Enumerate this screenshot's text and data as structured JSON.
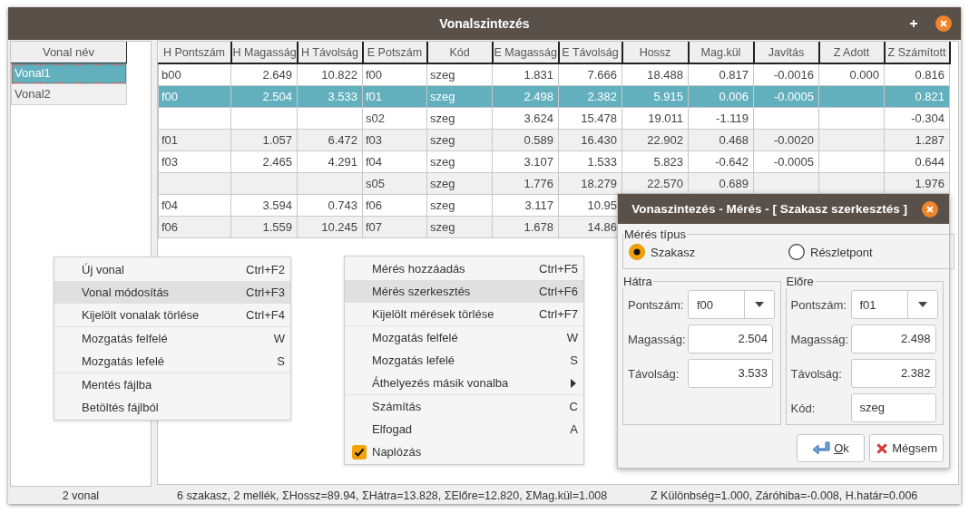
{
  "window": {
    "title": "Vonalszintezés"
  },
  "lines": {
    "header": "Vonal név",
    "items": [
      {
        "label": "Vonal1",
        "selected": true
      },
      {
        "label": "Vonal2",
        "selected": false
      }
    ]
  },
  "table": {
    "columns": [
      "H Pontszám",
      "H Magasság",
      "H Távolság",
      "E Potszám",
      "Kód",
      "E Magasság",
      "E Távolság",
      "Hossz",
      "Mag.kül",
      "Javítás",
      "Z Adott",
      "Z Számított"
    ],
    "rows": [
      {
        "selected": false,
        "cells": [
          "b00",
          "2.649",
          "10.822",
          "f00",
          "szeg",
          "1.831",
          "7.666",
          "18.488",
          "0.817",
          "-0.0016",
          "0.000",
          "0.816"
        ]
      },
      {
        "selected": true,
        "cells": [
          "f00",
          "2.504",
          "3.533",
          "f01",
          "szeg",
          "2.498",
          "2.382",
          "5.915",
          "0.006",
          "-0.0005",
          null,
          "0.821"
        ]
      },
      {
        "selected": false,
        "cells": [
          null,
          null,
          null,
          "s02",
          "szeg",
          "3.624",
          "15.478",
          "19.011",
          "-1.119",
          null,
          null,
          "-0.304"
        ]
      },
      {
        "selected": false,
        "cells": [
          "f01",
          "1.057",
          "6.472",
          "f03",
          "szeg",
          "0.589",
          "16.430",
          "22.902",
          "0.468",
          "-0.0020",
          null,
          "1.287"
        ]
      },
      {
        "selected": false,
        "cells": [
          "f03",
          "2.465",
          "4.291",
          "f04",
          "szeg",
          "3.107",
          "1.533",
          "5.823",
          "-0.642",
          "-0.0005",
          null,
          "0.644"
        ]
      },
      {
        "selected": false,
        "cells": [
          null,
          null,
          null,
          "s05",
          "szeg",
          "1.776",
          "18.279",
          "22.570",
          "0.689",
          null,
          null,
          "1.976"
        ]
      },
      {
        "selected": false,
        "cells": [
          "f04",
          "3.594",
          "0.743",
          "f06",
          "szeg",
          "3.117",
          "10.95"
        ]
      },
      {
        "selected": false,
        "cells": [
          "f06",
          "1.559",
          "10.245",
          "f07",
          "szeg",
          "1.678",
          "14.86"
        ]
      }
    ]
  },
  "context_menus": [
    {
      "items": [
        {
          "kind": "action",
          "label": "Új vonal",
          "shortcut": "Ctrl+F2",
          "selected": false
        },
        {
          "kind": "action",
          "label": "Vonal módosítás",
          "shortcut": "Ctrl+F3",
          "selected": true
        },
        {
          "kind": "action",
          "label": "Kijelölt vonalak törlése",
          "shortcut": "Ctrl+F4",
          "selected": false
        },
        {
          "kind": "separator"
        },
        {
          "kind": "action",
          "label": "Mozgatás felfelé",
          "shortcut": "W",
          "selected": false
        },
        {
          "kind": "action",
          "label": "Mozgatás lefelé",
          "shortcut": "S",
          "selected": false
        },
        {
          "kind": "separator"
        },
        {
          "kind": "action",
          "label": "Mentés fájlba",
          "selected": false
        },
        {
          "kind": "action",
          "label": "Betöltés fájlból",
          "selected": false
        }
      ]
    },
    {
      "items": [
        {
          "kind": "action",
          "label": "Mérés hozzáadás",
          "shortcut": "Ctrl+F5",
          "selected": false
        },
        {
          "kind": "action",
          "label": "Mérés szerkesztés",
          "shortcut": "Ctrl+F6",
          "selected": true
        },
        {
          "kind": "action",
          "label": "Kijelölt mérések törlése",
          "shortcut": "Ctrl+F7",
          "selected": false
        },
        {
          "kind": "separator"
        },
        {
          "kind": "action",
          "label": "Mozgatás felfelé",
          "shortcut": "W",
          "selected": false
        },
        {
          "kind": "action",
          "label": "Mozgatás lefelé",
          "shortcut": "S",
          "selected": false
        },
        {
          "kind": "submenu",
          "label": "Áthelyezés másik vonalba",
          "selected": false
        },
        {
          "kind": "separator"
        },
        {
          "kind": "action",
          "label": "Számítás",
          "shortcut": "C",
          "selected": false
        },
        {
          "kind": "action",
          "label": "Elfogad",
          "shortcut": "A",
          "selected": false
        },
        {
          "kind": "check",
          "label": "Naplózás",
          "checked": true,
          "selected": false
        }
      ]
    }
  ],
  "dialog": {
    "title": "Vonaszintezés - Mérés - [ Szakasz szerkesztés ]",
    "type_group": {
      "title": "Mérés típus",
      "options": [
        {
          "label": "Szakasz",
          "selected": true
        },
        {
          "label": "Részletpont",
          "selected": false
        }
      ]
    },
    "groups": [
      {
        "title": "Hátra",
        "fields": [
          {
            "kind": "combo",
            "label": "Pontszám:",
            "value": "f00"
          },
          {
            "kind": "number",
            "label": "Magasság:",
            "value": "2.504"
          },
          {
            "kind": "number",
            "label": "Távolság:",
            "value": "3.533"
          }
        ]
      },
      {
        "title": "Előre",
        "fields": [
          {
            "kind": "combo",
            "label": "Pontszám:",
            "value": "f01"
          },
          {
            "kind": "number",
            "label": "Magasság:",
            "value": "2.498"
          },
          {
            "kind": "number",
            "label": "Távolság:",
            "value": "2.382"
          },
          {
            "kind": "text",
            "label": "Kód:",
            "value": "szeg"
          }
        ]
      }
    ],
    "buttons": [
      {
        "kind": "ok",
        "label": "Ok"
      },
      {
        "kind": "cancel",
        "label": "Mégsem"
      }
    ]
  },
  "status_bar": [
    "2 vonal",
    "6 szakasz, 2 mellék, ΣHossz=89.94, ΣHátra=13.828, ΣElőre=12.820, ΣMag.kül=1.008",
    "Z Különbség=1.000, Záróhiba=-0.008, H.határ=0.006"
  ]
}
